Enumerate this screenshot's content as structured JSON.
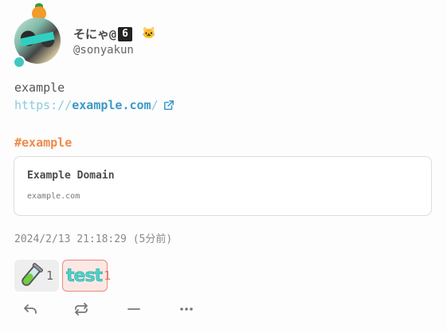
{
  "user": {
    "display_name": "そにゃ@",
    "name_emoji": "6",
    "badge_emoji": "🐱",
    "handle": "@sonyakun",
    "online": true
  },
  "note": {
    "text": "example",
    "url": {
      "proto": "https://",
      "host": "example.com",
      "slash": "/"
    },
    "hashtag": "#example",
    "timestamp": "2024/2/13 21:18:29 (5分前)"
  },
  "preview": {
    "title": "Example Domain",
    "site": "example.com"
  },
  "reactions": [
    {
      "emoji": "test-tube",
      "count": "1",
      "reacted": false
    },
    {
      "emoji_text": "test",
      "count": "1",
      "reacted": true
    }
  ],
  "actions": [
    "reply-icon",
    "renote-icon",
    "react-icon",
    "more-icon"
  ],
  "colors": {
    "accent": "#40c8c0",
    "link": "#3d9ac6",
    "hashtag": "#f08a4b",
    "reacted_border": "#e88a7a"
  }
}
